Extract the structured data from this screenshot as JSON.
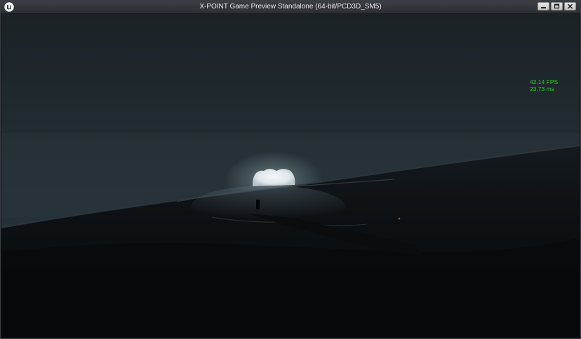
{
  "window": {
    "title": "X-POINT Game Preview Standalone (64-bit/PCD3D_SM5)",
    "app_icon": "unreal-engine-logo",
    "controls": [
      "minimize-icon",
      "maximize-icon",
      "close-icon"
    ]
  },
  "stats": {
    "fps": "42.14 FPS",
    "frame_time": "23.73 ms",
    "color": "#27d127"
  },
  "scene": {
    "description_colors": {
      "sky": "#1d262b",
      "ocean": "#0a0c0e",
      "moon": "#e8eef2"
    }
  }
}
